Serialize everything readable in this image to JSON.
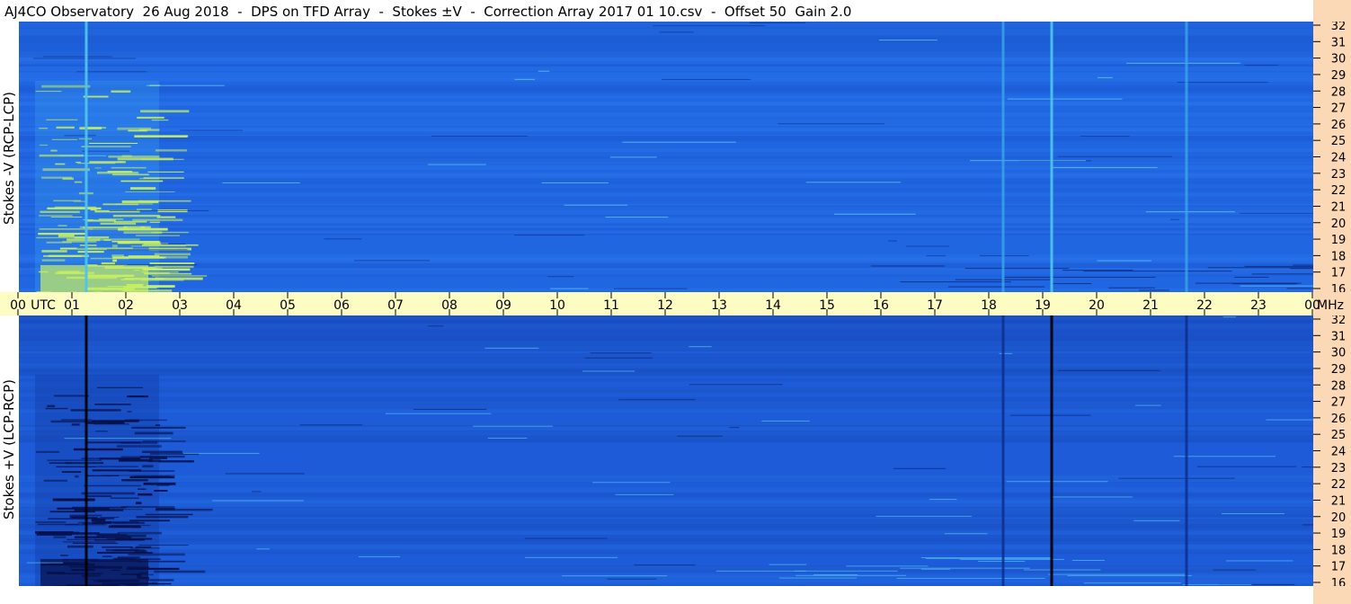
{
  "title": "AJ4CO Observatory  26 Aug 2018  -  DPS on TFD Array  -  Stokes ±V  -  Correction Array 2017 01 10.csv  -  Offset 50  Gain 2.0",
  "colors": {
    "background_blue": "#1f66e0",
    "time_band": "#fdfdc3",
    "freq_strip": "#fbd9b6",
    "hot": "#c8f060"
  },
  "chart_data": [
    {
      "type": "heatmap",
      "panel": "top",
      "ylabel": "Stokes -V (RCP-LCP)",
      "x_unit": "UTC",
      "y_unit": "MHz",
      "xlim": [
        0,
        24
      ],
      "ylim": [
        16,
        32
      ],
      "x_ticks": [
        "00",
        "01",
        "02",
        "03",
        "04",
        "05",
        "06",
        "07",
        "08",
        "09",
        "10",
        "11",
        "12",
        "13",
        "14",
        "15",
        "16",
        "17",
        "18",
        "19",
        "20",
        "21",
        "22",
        "23",
        "00"
      ],
      "y_ticks": [
        "32",
        "31",
        "30",
        "29",
        "28",
        "27",
        "26",
        "25",
        "24",
        "23",
        "22",
        "21",
        "20",
        "19",
        "18",
        "17",
        "16"
      ],
      "features": [
        {
          "kind": "vertical_line",
          "x": 1.25,
          "color": "#4fc3ee"
        },
        {
          "kind": "vertical_line",
          "x": 19.15,
          "color": "#4fc3ee"
        },
        {
          "kind": "vertical_line",
          "x": 18.25,
          "color": "#3aa8e8"
        },
        {
          "kind": "vertical_line",
          "x": 21.65,
          "color": "#3aa8e8"
        },
        {
          "kind": "storm",
          "x_range": [
            0.3,
            2.6
          ],
          "y_range": [
            16,
            28.5
          ],
          "color": "#c8f060"
        }
      ]
    },
    {
      "type": "heatmap",
      "panel": "bottom",
      "ylabel": "Stokes +V (LCP-RCP)",
      "x_unit": "UTC",
      "y_unit": "MHz",
      "xlim": [
        0,
        24
      ],
      "ylim": [
        16,
        32
      ],
      "x_ticks": [
        "00",
        "01",
        "02",
        "03",
        "04",
        "05",
        "06",
        "07",
        "08",
        "09",
        "10",
        "11",
        "12",
        "13",
        "14",
        "15",
        "16",
        "17",
        "18",
        "19",
        "20",
        "21",
        "22",
        "23",
        "00"
      ],
      "y_ticks": [
        "32",
        "31",
        "30",
        "29",
        "28",
        "27",
        "26",
        "25",
        "24",
        "23",
        "22",
        "21",
        "20",
        "19",
        "18",
        "17",
        "16"
      ],
      "features": [
        {
          "kind": "vertical_line",
          "x": 1.25,
          "color": "#000000"
        },
        {
          "kind": "vertical_line",
          "x": 19.15,
          "color": "#000000"
        },
        {
          "kind": "vertical_line",
          "x": 18.25,
          "color": "#0d2a8a"
        },
        {
          "kind": "vertical_line",
          "x": 21.65,
          "color": "#0d2a8a"
        },
        {
          "kind": "storm",
          "x_range": [
            0.3,
            2.6
          ],
          "y_range": [
            16,
            28.5
          ],
          "color": "#06104a"
        }
      ]
    }
  ],
  "axis": {
    "utc_label": "UTC",
    "mhz_label": "MHz"
  }
}
